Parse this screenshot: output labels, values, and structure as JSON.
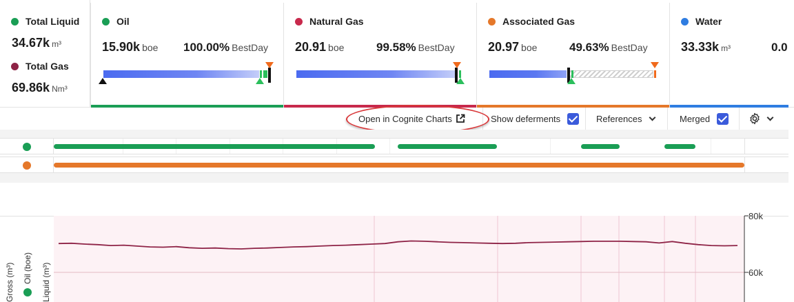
{
  "kpis": {
    "left": {
      "total_liquid": {
        "label": "Total Liquid",
        "value": "34.67k",
        "unit": "m³",
        "color": "#1a9e55"
      },
      "total_gas": {
        "label": "Total Gas",
        "value": "69.86k",
        "unit": "Nm³",
        "color": "#8e2346"
      }
    },
    "oil": {
      "label": "Oil",
      "value": "15.90k",
      "unit": "boe",
      "percent": "100.00%",
      "percent_label": "BestDay",
      "color": "#1a9e55",
      "progress": 1.0
    },
    "natural_gas": {
      "label": "Natural Gas",
      "value": "20.91",
      "unit": "boe",
      "percent": "99.58%",
      "percent_label": "BestDay",
      "color": "#c8294c",
      "progress": 0.9958
    },
    "associated_gas": {
      "label": "Associated Gas",
      "value": "20.97",
      "unit": "boe",
      "percent": "49.63%",
      "percent_label": "BestDay",
      "color": "#e5782a",
      "progress": 0.4963
    },
    "water": {
      "label": "Water",
      "value": "33.33k",
      "unit": "m³",
      "percent": "0.0",
      "color": "#2f7de1"
    }
  },
  "toolbar": {
    "open_cognite": "Open in Cognite Charts",
    "show_deferments": "Show deferments",
    "references": "References",
    "merged": "Merged"
  },
  "colors": {
    "bar_blue": "#4b6bf0",
    "annotation_red": "#d9383a",
    "series_line": "#8e2346",
    "timeline_green": "#1a9e55",
    "timeline_orange": "#e5782a"
  },
  "chart": {
    "y_axis_labels": [
      "80k",
      "60k"
    ],
    "left_labels": [
      "Gross (m³)",
      "Oil (boe)",
      "Liquid (m³)"
    ],
    "series_values": [
      70.2,
      70.3,
      70.0,
      69.8,
      69.5,
      69.6,
      69.3,
      69.0,
      68.9,
      69.1,
      68.7,
      68.5,
      68.6,
      68.4,
      68.3,
      68.5,
      68.6,
      68.8,
      69.0,
      69.1,
      69.3,
      69.5,
      69.6,
      69.8,
      70.0,
      70.2,
      70.8,
      71.1,
      71.0,
      70.8,
      70.6,
      70.5,
      70.4,
      70.3,
      70.2,
      70.3,
      70.5,
      70.6,
      70.7,
      70.8,
      70.9,
      71.0,
      71.0,
      71.0,
      70.9,
      70.8,
      70.4,
      70.9,
      70.3,
      69.8,
      69.5,
      69.4,
      69.5
    ],
    "y_range": [
      50,
      80
    ]
  }
}
